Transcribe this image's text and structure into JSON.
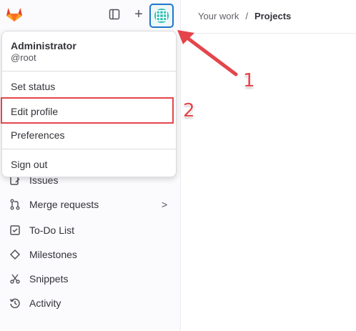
{
  "topbar": {
    "logo": "gitlab-logo-icon",
    "sidebar_toggle": "sidebar-toggle-icon",
    "create_new": "+",
    "avatar": "user-avatar-icon"
  },
  "breadcrumb": {
    "parent": "Your work",
    "separator": "/",
    "current": "Projects"
  },
  "user_menu": {
    "name": "Administrator",
    "handle": "@root",
    "items": {
      "set_status": "Set status",
      "edit_profile": "Edit profile",
      "preferences": "Preferences",
      "sign_out": "Sign out"
    }
  },
  "nav": {
    "items": [
      {
        "label": "Issues",
        "icon": "issues-icon"
      },
      {
        "label": "Merge requests",
        "icon": "merge-request-icon",
        "chevron": ">"
      },
      {
        "label": "To-Do List",
        "icon": "todo-icon"
      },
      {
        "label": "Milestones",
        "icon": "milestone-icon"
      },
      {
        "label": "Snippets",
        "icon": "snippets-icon"
      },
      {
        "label": "Activity",
        "icon": "activity-icon"
      }
    ]
  },
  "annotations": {
    "step1": "1",
    "step2": "2",
    "accent_color": "#e4454b"
  }
}
